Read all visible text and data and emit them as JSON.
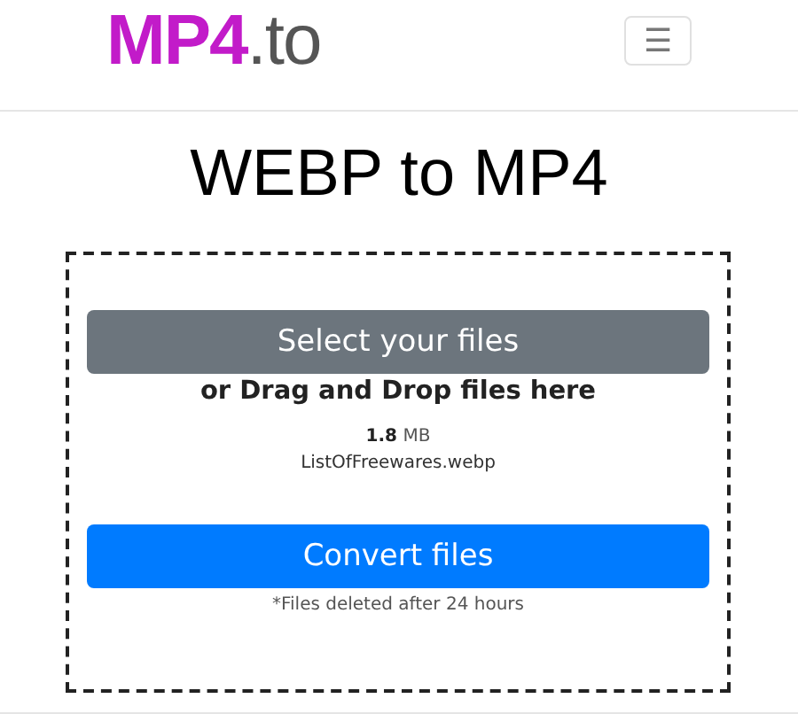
{
  "header": {
    "logo": "**MP4**.to",
    "menu_button": "☰"
  },
  "title": "WEBP to MP4",
  "upload": {
    "select_button": "Select your files",
    "drop_hint": "or Drag and Drop files here",
    "file": {
      "size": "**1.8** MB",
      "name": "ListOfFreewares.webp"
    },
    "convert_button": "Convert files",
    "note": "*Files deleted after 24 hours"
  }
}
